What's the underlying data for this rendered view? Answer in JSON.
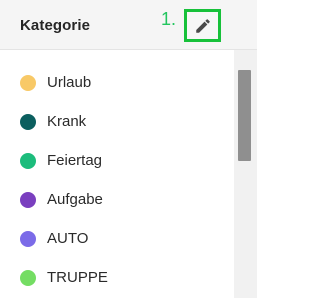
{
  "header": {
    "title": "Kategorie",
    "step_label": "1."
  },
  "edit_icon": "pencil-icon",
  "categories": [
    {
      "label": "Urlaub",
      "color": "#f8c967"
    },
    {
      "label": "Krank",
      "color": "#0b5f5f"
    },
    {
      "label": "Feiertag",
      "color": "#1cbc7c"
    },
    {
      "label": "Aufgabe",
      "color": "#7a3fbf"
    },
    {
      "label": "AUTO",
      "color": "#7b6be8"
    },
    {
      "label": "TRUPPE",
      "color": "#74dd63"
    }
  ],
  "accent_color": "#17c13a"
}
